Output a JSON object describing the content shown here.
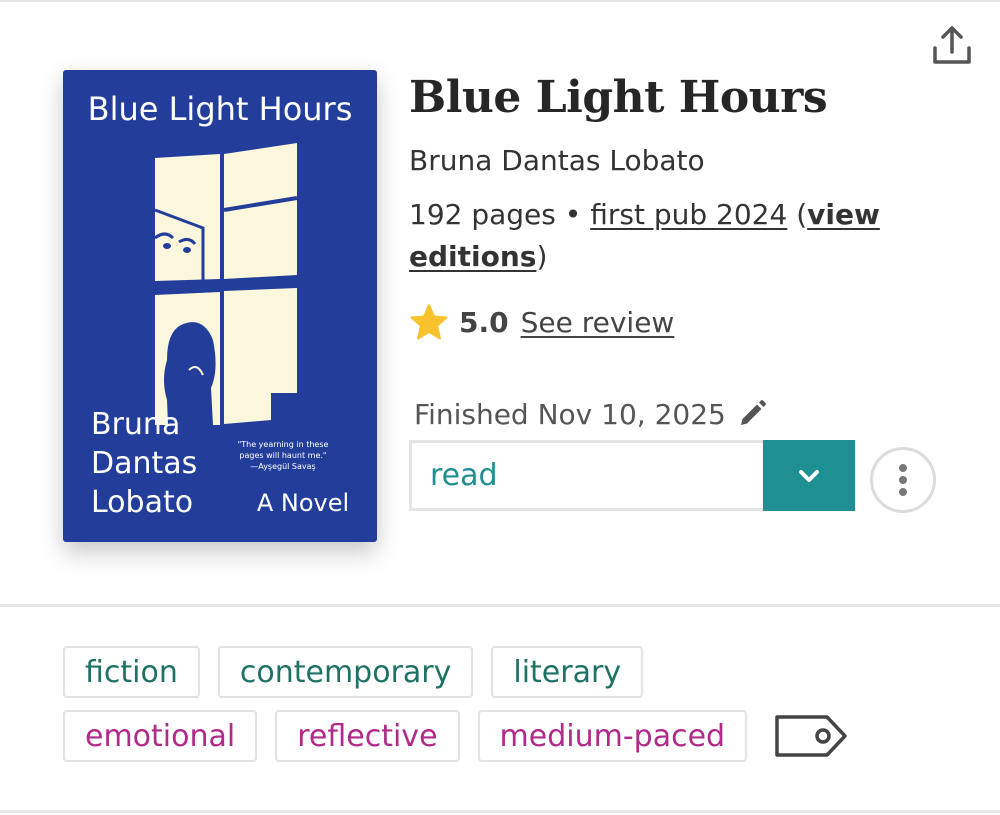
{
  "book": {
    "title": "Blue Light Hours",
    "author": "Bruna Dantas Lobato",
    "pages": "192 pages",
    "separator": "•",
    "first_pub": "first pub 2024",
    "open_paren": "(",
    "view_editions": "view editions",
    "close_paren": ")"
  },
  "cover": {
    "title": "Blue Light Hours",
    "author_lines": [
      "Bruna",
      "Dantas",
      "Lobato"
    ],
    "subtitle": "A Novel",
    "quote_lines": [
      "\"The yearning in these",
      "pages will haunt me.\"",
      "—Ayşegül Savaş"
    ],
    "bg_color": "#233e9a",
    "window_color": "#fbf7dc"
  },
  "rating": {
    "value": "5.0",
    "link": "See review",
    "icon": "star-icon"
  },
  "finished": {
    "text": "Finished Nov 10, 2025",
    "icon": "pencil-icon"
  },
  "status": {
    "selected": "read",
    "caret_icon": "chevron-down-icon",
    "accent": "#1e8f93"
  },
  "more": {
    "icon": "more-vertical-icon"
  },
  "share": {
    "icon": "share-icon"
  },
  "tags": {
    "genres": [
      "fiction",
      "contemporary",
      "literary"
    ],
    "moods": [
      "emotional",
      "reflective",
      "medium-paced"
    ],
    "add_icon": "tag-icon",
    "genre_color": "#1d7264",
    "mood_color": "#b02a8a"
  }
}
